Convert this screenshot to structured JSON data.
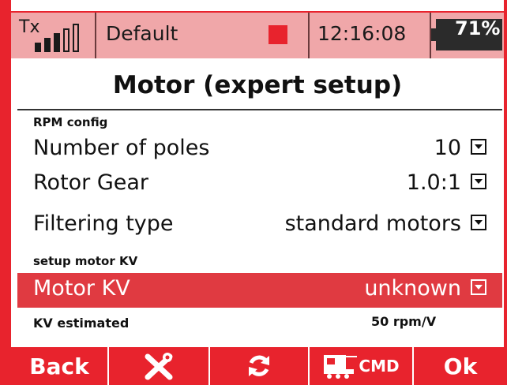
{
  "status_bar": {
    "tx_label": "Tx",
    "signal_bars_filled": 3,
    "signal_bars_total": 5,
    "model_name": "Default",
    "time": "12:16:08",
    "battery_percent": "71%"
  },
  "page_title": "Motor (expert setup)",
  "sections": {
    "rpm_config": "RPM config",
    "setup_motor_kv": "setup motor KV"
  },
  "rows": {
    "poles": {
      "label": "Number of poles",
      "value": "10"
    },
    "rotor_gear": {
      "label": "Rotor Gear",
      "value": "1.0:1"
    },
    "filtering": {
      "label": "Filtering type",
      "value": "standard motors"
    },
    "motor_kv": {
      "label": "Motor KV",
      "value": "unknown"
    }
  },
  "kv_estimated": {
    "label": "KV estimated",
    "value": "50 rpm/V"
  },
  "function_buttons": {
    "back": "Back",
    "ok": "Ok",
    "cmd": "CMD",
    "tools_icon": "wrench-screwdriver-icon",
    "refresh_icon": "refresh-icon",
    "cmd_icon": "vehicle-cmd-icon"
  },
  "colors": {
    "accent": "#e8232d",
    "status_bg": "#f0a7a9",
    "selected_row": "#e03a41"
  }
}
